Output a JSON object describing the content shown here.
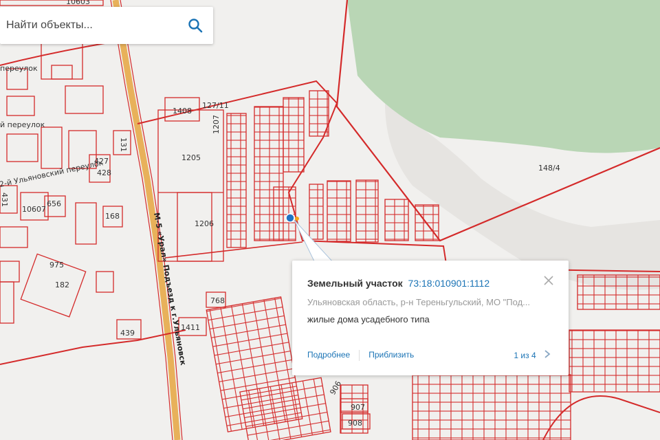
{
  "search": {
    "placeholder": "Найти объекты..."
  },
  "icons": {
    "search": "search-icon",
    "close": "close-icon",
    "next": "chevron-right-icon"
  },
  "colors": {
    "parcel_outline": "#d42a2a",
    "accent": "#1a73b5",
    "forest": "#b7d6b3",
    "road": "#e8b15a"
  },
  "map_labels": {
    "l10603": "10603",
    "pereulok1": "переулок",
    "pereulok2": "й переулок",
    "ulyan_per": "2-й Ульяновский переулок",
    "l1408": "1408",
    "l127_11": "127/11",
    "l1207": "1207",
    "l1205": "1205",
    "l1206": "1206",
    "l131": "131",
    "l427": "427",
    "l428": "428",
    "l431": "431",
    "l10607": "10607",
    "l656": "656",
    "l168": "168",
    "l975": "975",
    "l182": "182",
    "l768": "768",
    "l1411": "1411",
    "l439": "439",
    "l148_4": "148/4",
    "l906": "906",
    "l907": "907",
    "l908": "908",
    "road_m5": "М-5 «Урал» Подъезд к г.Ульяновск"
  },
  "popup": {
    "type_label": "Земельный участок",
    "cadastral_number": "73:18:010901:1112",
    "address": "Ульяновская область, р-н Тереньгульский, МО \"Под...",
    "description": "жилые дома усадебного типа",
    "details_link": "Подробнее",
    "zoom_link": "Приблизить",
    "pager": "1 из 4"
  }
}
